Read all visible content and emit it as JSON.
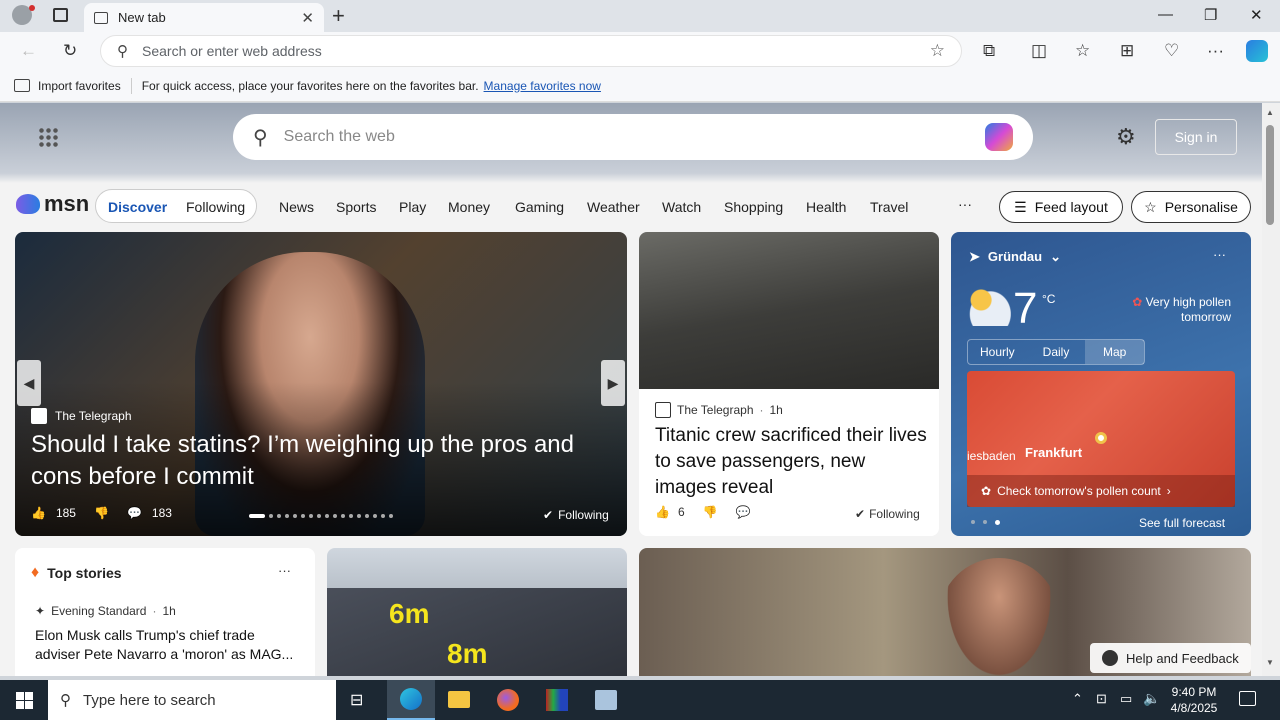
{
  "browser": {
    "tab_title": "New tab",
    "address_placeholder": "Search or enter web address"
  },
  "favbar": {
    "import": "Import favorites",
    "hint": "For quick access, place your favorites here on the favorites bar.",
    "manage": "Manage favorites now"
  },
  "msn": {
    "search_placeholder": "Search the web",
    "signin": "Sign in",
    "logo": "msn",
    "tabs": [
      "Discover",
      "Following"
    ],
    "nav": [
      "News",
      "Sports",
      "Play",
      "Money",
      "Gaming",
      "Weather",
      "Watch",
      "Shopping",
      "Health",
      "Travel"
    ],
    "more": "···",
    "feed_layout": "Feed layout",
    "personalise": "Personalise"
  },
  "hero": {
    "source": "The Telegraph",
    "headline": "Should I take statins? I’m weighing up the pros and cons before I commit",
    "likes": "185",
    "comments": "183",
    "following": "Following"
  },
  "titanic": {
    "source": "The Telegraph",
    "time": "1h",
    "headline": "Titanic crew sacrificed their lives to save passengers, new images reveal",
    "likes": "6",
    "following": "Following"
  },
  "weather": {
    "location": "Gründau",
    "temp": "7",
    "unit": "°C",
    "pollen": "Very high pollen tomorrow",
    "tabs": [
      "Hourly",
      "Daily",
      "Map"
    ],
    "city": "Frankfurt",
    "city2": "iesbaden",
    "cta": "Check tomorrow's pollen count",
    "forecast": "See full forecast",
    "more": "···"
  },
  "topstories": {
    "title": "Top stories",
    "source": "Evening Standard",
    "time": "1h",
    "headline": "Elon Musk calls Trump's chief trade adviser Pete Navarro a 'moron' as MAG...",
    "more": "···"
  },
  "solar": {
    "label1": "6m",
    "label2": "8m"
  },
  "help": "Help and Feedback",
  "taskbar": {
    "search": "Type here to search",
    "time": "9:40 PM",
    "date": "4/8/2025"
  }
}
